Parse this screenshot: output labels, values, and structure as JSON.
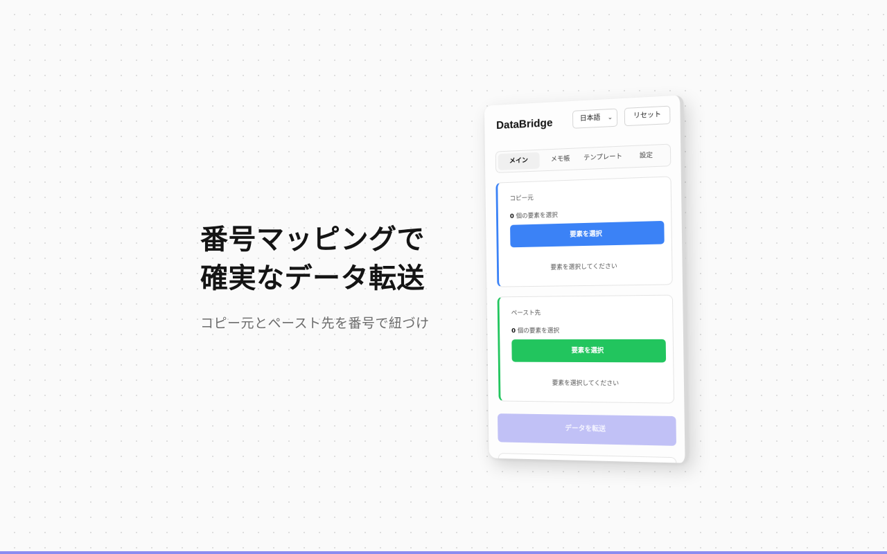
{
  "hero": {
    "title_line1": "番号マッピングで",
    "title_line2": "確実なデータ転送",
    "subtitle": "コピー元とペースト先を番号で紐づけ"
  },
  "panel": {
    "app_title": "DataBridge",
    "language": {
      "selected": "日本語"
    },
    "reset_label": "リセット",
    "tabs": [
      {
        "label": "メイン",
        "active": true
      },
      {
        "label": "メモ帳",
        "active": false
      },
      {
        "label": "テンプレート",
        "active": false
      },
      {
        "label": "設定",
        "active": false
      }
    ],
    "source": {
      "label": "コピー元",
      "count": "0",
      "count_suffix": "個の要素を選択",
      "button": "要素を選択",
      "hint": "要素を選択してください",
      "accent": "#3b82f6"
    },
    "target": {
      "label": "ペースト先",
      "count": "0",
      "count_suffix": "個の要素を選択",
      "button": "要素を選択",
      "hint": "要素を選択してください",
      "accent": "#22c55e"
    },
    "transfer_label": "データを転送",
    "transfer_color": "#c1c1f6"
  },
  "colors": {
    "bottom_bar": "#8b8cf0",
    "background": "#fafafa"
  },
  "icons": {
    "language_dropdown": "chevron-down-icon"
  }
}
